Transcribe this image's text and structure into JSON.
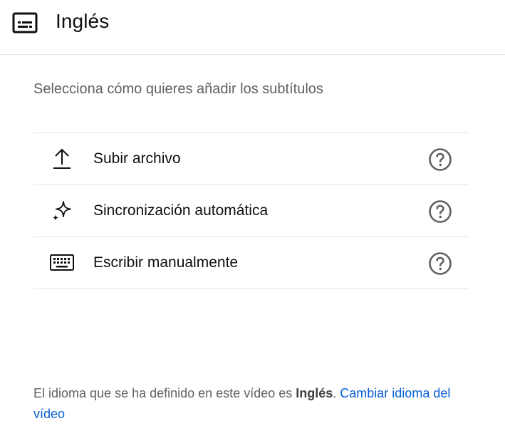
{
  "header": {
    "title": "Inglés",
    "icon": "subtitles-icon"
  },
  "prompt": "Selecciona cómo quieres añadir los subtítulos",
  "options": [
    {
      "label": "Subir archivo",
      "icon": "upload-icon"
    },
    {
      "label": "Sincronización automática",
      "icon": "sparkle-icon"
    },
    {
      "label": "Escribir manualmente",
      "icon": "keyboard-icon"
    }
  ],
  "footer": {
    "text_before": "El idioma que se ha definido en este vídeo es ",
    "language": "Inglés",
    "text_after": ". ",
    "link": "Cambiar idioma del vídeo"
  },
  "colors": {
    "link": "#065fd4",
    "secondary_text": "#606060",
    "divider": "#e5e5e5"
  }
}
